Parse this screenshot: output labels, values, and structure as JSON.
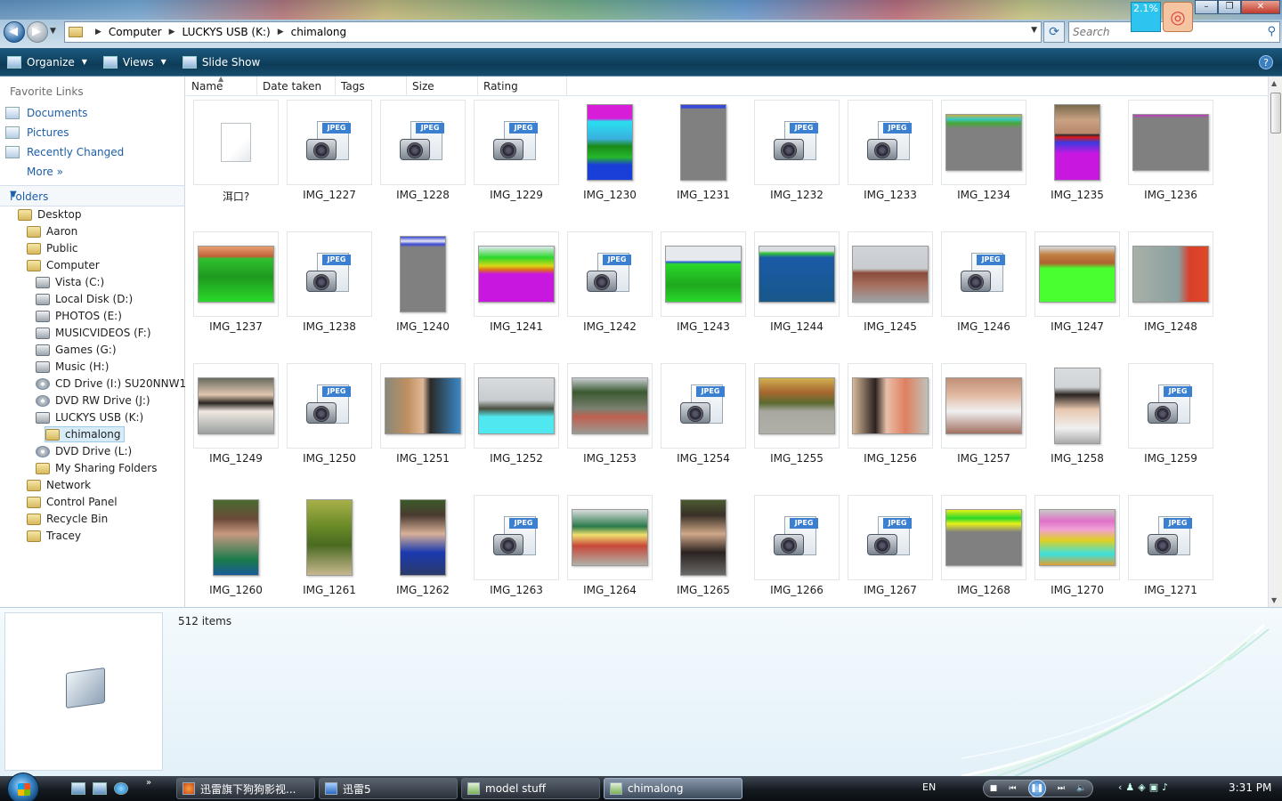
{
  "window": {
    "breadcrumb": [
      "Computer",
      "LUCKYS USB (K:)",
      "chimalong"
    ],
    "search_placeholder": "Search",
    "cpu_gadget": "2.1%"
  },
  "toolbar": {
    "organize": "Organize",
    "views": "Views",
    "slideshow": "Slide Show"
  },
  "nav": {
    "favorites_title": "Favorite Links",
    "favorites": [
      "Documents",
      "Pictures",
      "Recently Changed"
    ],
    "more": "More",
    "folders_label": "Folders",
    "tree": [
      {
        "label": "Desktop",
        "kind": "folder"
      },
      {
        "label": "Aaron",
        "kind": "folder"
      },
      {
        "label": "Public",
        "kind": "folder"
      },
      {
        "label": "Computer",
        "kind": "folder"
      },
      {
        "label": "Vista (C:)",
        "kind": "drive"
      },
      {
        "label": "Local Disk (D:)",
        "kind": "drive"
      },
      {
        "label": "PHOTOS (E:)",
        "kind": "drive"
      },
      {
        "label": "MUSICVIDEOS (F:)",
        "kind": "drive"
      },
      {
        "label": "Games (G:)",
        "kind": "drive"
      },
      {
        "label": "Music (H:)",
        "kind": "drive"
      },
      {
        "label": "CD Drive (I:) SU20NNW1",
        "kind": "disc"
      },
      {
        "label": "DVD RW Drive (J:)",
        "kind": "disc"
      },
      {
        "label": "LUCKYS USB (K:)",
        "kind": "drive"
      },
      {
        "label": "chimalong",
        "kind": "folder",
        "selected": true
      },
      {
        "label": "DVD Drive (L:)",
        "kind": "disc"
      },
      {
        "label": "My Sharing Folders",
        "kind": "folder"
      },
      {
        "label": "Network",
        "kind": "folder"
      },
      {
        "label": "Control Panel",
        "kind": "folder"
      },
      {
        "label": "Recycle Bin",
        "kind": "folder"
      },
      {
        "label": "Tracey",
        "kind": "folder"
      }
    ]
  },
  "columns": [
    "Name",
    "Date taken",
    "Tags",
    "Size",
    "Rating"
  ],
  "files": [
    {
      "name": "洱口?",
      "kind": "blank"
    },
    {
      "name": "IMG_1227",
      "kind": "jpeg"
    },
    {
      "name": "IMG_1228",
      "kind": "jpeg"
    },
    {
      "name": "IMG_1229",
      "kind": "jpeg"
    },
    {
      "name": "IMG_1230",
      "kind": "photo",
      "orient": "portrait",
      "bg": "linear-gradient(#d81dd8 0%,#d81dd8 18%,#28e0f0 22%,#3ab0e0 45%,#1a8a18 55%,#25b82a 70%,#1a3ed8 80%,#1a3ed8 100%)"
    },
    {
      "name": "IMG_1231",
      "kind": "photo",
      "orient": "portrait",
      "bg": "linear-gradient(#3a4ad8 0%,#3a4ad8 4%,#808080 5%,#808080 100%)"
    },
    {
      "name": "IMG_1232",
      "kind": "jpeg"
    },
    {
      "name": "IMG_1233",
      "kind": "jpeg"
    },
    {
      "name": "IMG_1234",
      "kind": "photo",
      "orient": "landscape",
      "bg": "linear-gradient(#c8b040 0%,#38c8c8 8%,#48a838 15%,#808080 25%,#808080 100%)"
    },
    {
      "name": "IMG_1235",
      "kind": "photo",
      "orient": "portrait",
      "bg": "linear-gradient(#7a6a4e 0%,#c9a183 20%,#b8876a 38%,#2a2a2a 40%,#e01818 43%,#3a3ae0 50%,#c818e0 65%,#c818e0 100%)"
    },
    {
      "name": "IMG_1236",
      "kind": "photo",
      "orient": "landscape",
      "bg": "linear-gradient(#c03ac0 0%,#808080 6%,#808080 100%)"
    },
    {
      "name": "IMG_1237",
      "kind": "photo",
      "orient": "landscape",
      "bg": "linear-gradient(#e8a070 0%,#c0603a 18%,#30c030 22%,#1e9a1e 55%,#2ad82a 100%)"
    },
    {
      "name": "IMG_1238",
      "kind": "jpeg"
    },
    {
      "name": "IMG_1240",
      "kind": "photo",
      "orient": "portrait",
      "bg": "linear-gradient(#3a4ad8 0%,#e8e8f0 6%,#3a4ad8 10%,#808080 14%,#808080 100%)"
    },
    {
      "name": "IMG_1241",
      "kind": "photo",
      "orient": "landscape",
      "bg": "linear-gradient(#e0e8f0 0%,#2ad82a 20%,#d8d818 35%,#e07018 42%,#c818e0 50%,#c818e0 100%)"
    },
    {
      "name": "IMG_1242",
      "kind": "jpeg"
    },
    {
      "name": "IMG_1243",
      "kind": "photo",
      "orient": "landscape",
      "bg": "linear-gradient(#e6eaee 0%,#e6eaee 25%,#2a5ad8 28%,#2ad82a 32%,#1ea81e 70%,#2ad82a 100%)"
    },
    {
      "name": "IMG_1244",
      "kind": "photo",
      "orient": "landscape",
      "bg": "linear-gradient(#d8dde2 0%,#d8dde2 8%,#38c838 12%,#1a5aa8 20%,#18588a 100%)"
    },
    {
      "name": "IMG_1245",
      "kind": "photo",
      "orient": "landscape",
      "bg": "linear-gradient(#d0d4d8 0%,#c8ccd0 40%,#8a4a3a 48%,#a87060 70%,#9ca2a6 100%)"
    },
    {
      "name": "IMG_1246",
      "kind": "jpeg"
    },
    {
      "name": "IMG_1247",
      "kind": "photo",
      "orient": "landscape",
      "bg": "linear-gradient(#d8dde2 0%,#c08040 15%,#b06030 30%,#4aff30 40%,#4aff30 100%)"
    },
    {
      "name": "IMG_1248",
      "kind": "photo",
      "orient": "landscape",
      "bg": "linear-gradient(90deg,#a8b0a8 0%,#8aa0a0 60%,#d8402a 75%,#e04828 100%)"
    },
    {
      "name": "IMG_1249",
      "kind": "photo",
      "orient": "landscape",
      "bg": "linear-gradient(#6a6a60 0%,#e0c8b0 30%,#2a2420 45%,#f0e8e0 60%,#9aa0a0 100%)"
    },
    {
      "name": "IMG_1250",
      "kind": "jpeg"
    },
    {
      "name": "IMG_1251",
      "kind": "photo",
      "orient": "landscape",
      "bg": "linear-gradient(90deg,#8a8878 0%,#c09060 30%,#e0b898 50%,#2a2a28 60%,#3a88c8 100%)"
    },
    {
      "name": "IMG_1252",
      "kind": "photo",
      "orient": "landscape",
      "bg": "linear-gradient(#d8dcde 0%,#c8ccce 40%,#4a5040 55%,#50e8f0 70%,#50e8f0 100%)"
    },
    {
      "name": "IMG_1253",
      "kind": "photo",
      "orient": "landscape",
      "bg": "linear-gradient(#c8ccd0 0%,#3a5a30 25%,#7a8070 55%,#c06050 70%,#9a9a92 100%)"
    },
    {
      "name": "IMG_1254",
      "kind": "jpeg"
    },
    {
      "name": "IMG_1255",
      "kind": "photo",
      "orient": "landscape",
      "bg": "linear-gradient(#d0b050 0%,#a86830 25%,#5a6a30 45%,#a8a8a0 60%,#b0b0a8 100%)"
    },
    {
      "name": "IMG_1256",
      "kind": "photo",
      "orient": "landscape",
      "bg": "linear-gradient(90deg,#d8b898 0%,#2a2220 30%,#e8c0a8 45%,#e08060 70%,#c0c0b8 100%)"
    },
    {
      "name": "IMG_1257",
      "kind": "photo",
      "orient": "landscape",
      "bg": "linear-gradient(#c09078 0%,#e0b8a0 30%,#f0f0f0 60%,#a07060 100%)"
    },
    {
      "name": "IMG_1258",
      "kind": "photo",
      "orient": "portrait",
      "bg": "linear-gradient(#d8dcde 0%,#d0d4d6 25%,#2a2420 35%,#e8c8b0 55%,#f0f0f0 80%,#a8aaa8 100%)"
    },
    {
      "name": "IMG_1259",
      "kind": "jpeg"
    },
    {
      "name": "IMG_1260",
      "kind": "photo",
      "orient": "portrait",
      "bg": "linear-gradient(#4a6a30 0%,#6a4a38 25%,#c89880 45%,#1a7a4a 80%,#1a5a98 100%)"
    },
    {
      "name": "IMG_1261",
      "kind": "photo",
      "orient": "portrait",
      "bg": "linear-gradient(#a8b048 0%,#6a8a28 35%,#4a6a20 60%,#c8b890 100%)"
    },
    {
      "name": "IMG_1262",
      "kind": "photo",
      "orient": "portrait",
      "bg": "linear-gradient(#3a5a28 0%,#4a3a30 20%,#d8b098 45%,#1a3ab0 70%,#2a3a6a 100%)"
    },
    {
      "name": "IMG_1263",
      "kind": "jpeg"
    },
    {
      "name": "IMG_1264",
      "kind": "photo",
      "orient": "landscape",
      "bg": "linear-gradient(#d8dcde 0%,#2a7a4a 30%,#f0e070 45%,#c84838 65%,#b0b0a8 100%)"
    },
    {
      "name": "IMG_1265",
      "kind": "photo",
      "orient": "portrait",
      "bg": "linear-gradient(#4a5a30 0%,#3a3028 20%,#d0a888 45%,#2a2220 70%,#6a6a68 100%)"
    },
    {
      "name": "IMG_1266",
      "kind": "jpeg"
    },
    {
      "name": "IMG_1267",
      "kind": "jpeg"
    },
    {
      "name": "IMG_1268",
      "kind": "photo",
      "orient": "landscape",
      "bg": "linear-gradient(#e8f018 0%,#2ad82a 15%,#e8f018 25%,#808080 40%,#808080 100%)"
    },
    {
      "name": "IMG_1270",
      "kind": "photo",
      "orient": "landscape",
      "bg": "linear-gradient(#c8c8c8 0%,#e070c8 20%,#f0a0d8 35%,#e0d020 55%,#3ae0e0 80%,#e0a030 100%)"
    },
    {
      "name": "IMG_1271",
      "kind": "jpeg"
    }
  ],
  "details": {
    "item_count": "512 items"
  },
  "taskbar": {
    "tasks": [
      "迅雷旗下狗狗影视...",
      "迅雷5",
      "model stuff",
      "chimalong"
    ],
    "language": "EN",
    "clock": "3:31 PM"
  }
}
